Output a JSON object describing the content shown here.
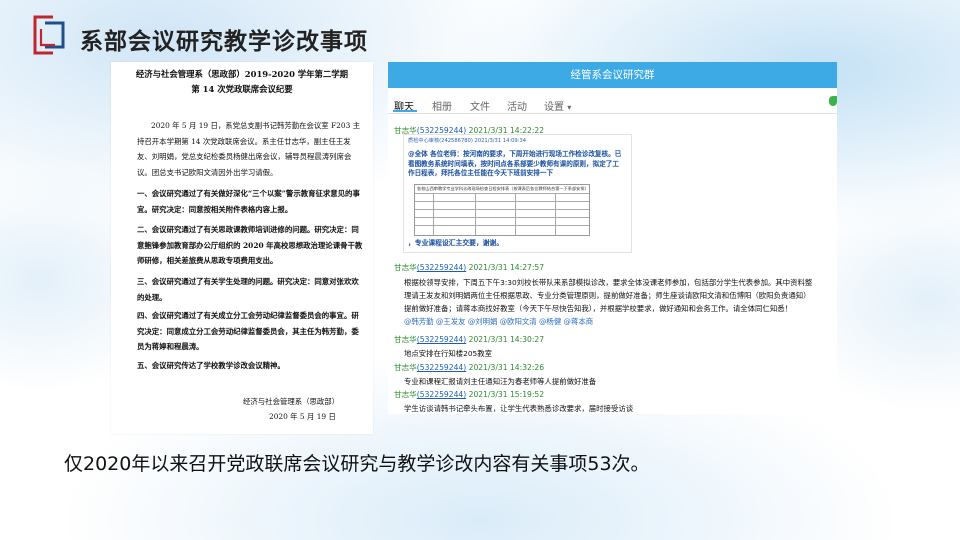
{
  "slide": {
    "title": "系部会议研究教学诊改事项",
    "caption": "仅2020年以来召开党政联席会议研究与教学诊改内容有关事项53次。"
  },
  "colors": {
    "logo_red": "#c0272d",
    "logo_blue": "#1f4e8c",
    "chat_accent": "#3daae6",
    "sender_green": "#2e8b2e"
  },
  "document": {
    "heading_line1": "经济与社会管理系（思政部）2019-2020 学年第二学期",
    "heading_line2": "第 14 次党政联席会议纪要",
    "paragraphs": [
      "2020 年 5 月 19 日，系党总支副书记韩芳勤在会议室 F203 主持召开本学期第 14 次党政联席会议。系主任廿志华，副主任王发友、刘明娟，党总支纪检委员杨健出席会议，辅导员程晨涛列席会议。团总支书记欧阳文清因外出学习请假。",
      "一、会议研究通过了有关做好深化“三个以案”警示教育征求意见的事宜。研究决定：同意按相关附件表格内容上报。",
      "二、会议研究通过了有关思政课教师培训进修的问题。研究决定：同意鲍锋参加教育部办公厅组织的 2020 年高校思想政治理论课骨干教师研修，相关差旅费从思政专项费用支出。",
      "三、会议研究通过了有关学生处理的问题。研究决定：同意对张欢欢的处理。",
      "四、会议研究通过了有关成立分工会劳动纪律监督委员会的事宜。研究决定：同意成立分工会劳动纪律监督委员会，其主任为韩芳勤，委员为蒋婷和程晨涛。",
      "五、会议研究传达了学校教学诊改会议精神。"
    ],
    "signature_org": "经济与社会管理系（思政部）",
    "signature_date": "2020 年 5 月 19 日"
  },
  "chat": {
    "window_title": "经管系会议研究群",
    "tabs": [
      "聊天",
      "相册",
      "文件",
      "活动",
      "设置"
    ],
    "messages": [
      {
        "sender": "甘志华",
        "qq": "(532259244)",
        "time": "2021/3/31 14:22:22",
        "screenshot": {
          "header": "质检中心审核(242586780)  2021/3/31 14:09:34",
          "text": "@全体 各位老师：按河南的要求，下周开始进行现场工作检诊改复核。已看图教务系统时间填表，按时间点各系部要少教师有课的原则，拟定了工作日程表，拜托各位主任能在今天下班前安排一下",
          "table_title": "各校山西审教学专业学科诊改现场检查日程安排表（按课表后各位教师结合第一下系部安排）",
          "footer": "，专业课程设汇主交要，谢谢。"
        }
      },
      {
        "sender": "甘志华",
        "qq": "(532259244)",
        "time": "2021/3/31 14:27:57",
        "lines": [
          "根据校领导安排，下周五下午3:30刘校长带队来系部模拟诊改，要求全体没课老师参加，包括部分学生代表参加。其中资料整",
          "理请王发友和刘明娟两位主任根据思政、专业分类管理原则，提前做好准备；师生座谈请欧阳文清和伍博阳（欧阳负责通知）",
          "提前做好准备；请蒋本商找好教室（今天下午尽快告知我），并根据学校要求，做好通知和会务工作。请全体同仁知悉！"
        ],
        "mentions": "@韩芳勤 @王发友 @刘明娟 @欧阳文清 @杨健 @蒋本商"
      },
      {
        "sender": "甘志华",
        "qq": "(532259244)",
        "time": "2021/3/31 14:30:27",
        "lines": [
          "地点安排在行知楼205教室"
        ]
      },
      {
        "sender": "甘志华",
        "qq": "(532259244)",
        "time": "2021/3/31 14:32:26",
        "lines": [
          "专业和课程汇报请刘主任通知汪为春老师等人提前做好准备"
        ]
      },
      {
        "sender": "甘志华",
        "qq": "(532259244)",
        "time": "2021/3/31 15:19:52",
        "lines": [
          "学生访谈请韩书记牵头布置，让学生代表熟悉诊改要求，届时接受访谈"
        ]
      }
    ]
  }
}
